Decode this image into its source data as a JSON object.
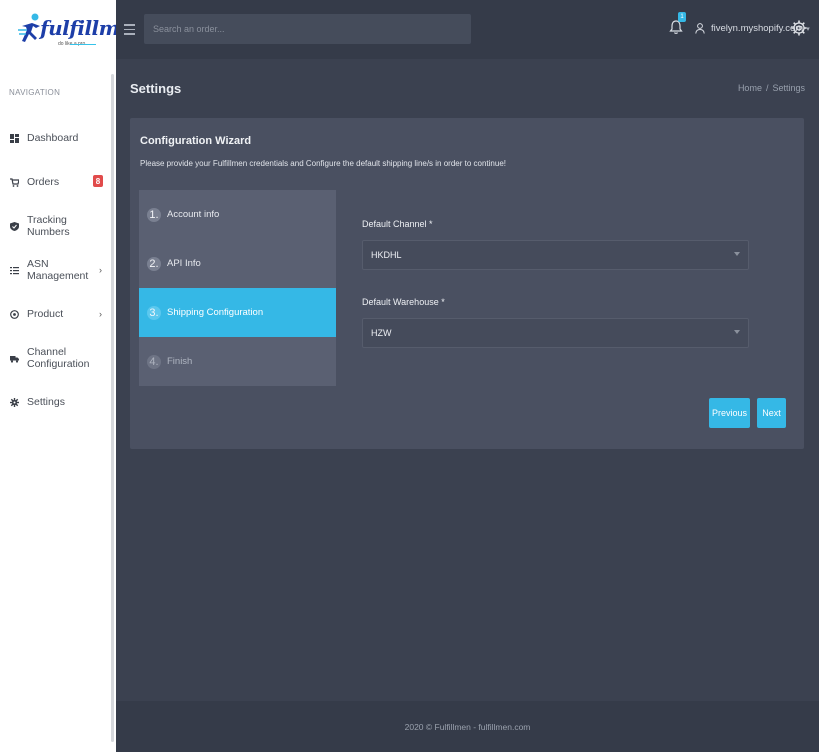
{
  "brand": {
    "name": "fulfillmen",
    "tagline": "do like a pro"
  },
  "sidebar": {
    "heading": "NAVIGATION",
    "items": [
      {
        "label": "Dashboard",
        "icon": "dashboard-icon"
      },
      {
        "label": "Orders",
        "icon": "cart-icon",
        "badge": "8"
      },
      {
        "label": "Tracking Numbers",
        "icon": "shield-icon"
      },
      {
        "label": "ASN Management",
        "icon": "list-icon",
        "chevron": "›"
      },
      {
        "label": "Product",
        "icon": "gift-icon",
        "chevron": "›"
      },
      {
        "label": "Channel Configuration",
        "icon": "truck-icon"
      },
      {
        "label": "Settings",
        "icon": "gear-icon"
      }
    ]
  },
  "topbar": {
    "search_placeholder": "Search an order...",
    "notification_count": "1",
    "user": "fivelyn.myshopify.com",
    "caret": "▾"
  },
  "page": {
    "title": "Settings",
    "breadcrumb": {
      "home": "Home",
      "separator": "/",
      "current": "Settings"
    }
  },
  "wizard": {
    "title": "Configuration Wizard",
    "subtitle": "Please provide your Fulfillmen credentials and Configure the default shipping line/s in order to continue!",
    "steps": [
      {
        "num": "1.",
        "label": "Account info",
        "state": "done"
      },
      {
        "num": "2.",
        "label": "API Info",
        "state": "done"
      },
      {
        "num": "3.",
        "label": "Shipping Configuration",
        "state": "active"
      },
      {
        "num": "4.",
        "label": "Finish",
        "state": "pending"
      }
    ],
    "channel": {
      "label": "Default Channel *",
      "value": "HKDHL"
    },
    "warehouse": {
      "label": "Default Warehouse *",
      "value": "HZW"
    },
    "previous_label": "Previous",
    "next_label": "Next"
  },
  "footer": {
    "text": "2020 © Fulfillmen - fulfillmen.com"
  },
  "colors": {
    "accent": "#35b8e6",
    "badge": "#e14b4b",
    "brand": "#1d3ea8"
  }
}
